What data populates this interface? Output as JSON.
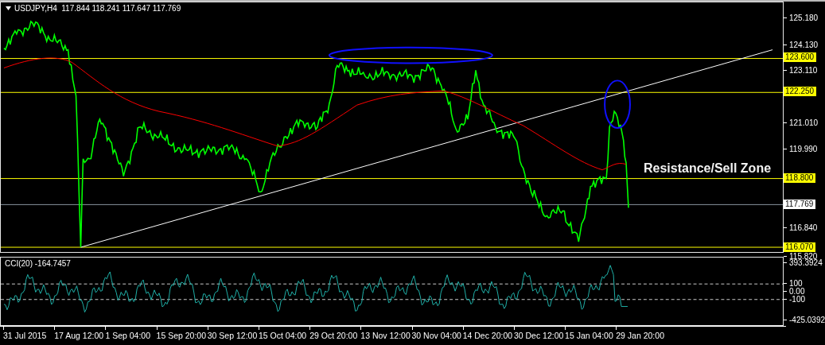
{
  "chart": {
    "header": "USDJPY,H4  117.844 118.241 117.647 117.769",
    "annotation": "Resistance/Sell Zone",
    "price_ticks": [
      "125.180",
      "124.130",
      "123.110",
      "121.010",
      "119.990",
      "116.840",
      "115.820"
    ],
    "price_levels": [
      {
        "label": "123.600",
        "kind": "level"
      },
      {
        "label": "122.250",
        "kind": "level"
      },
      {
        "label": "118.800",
        "kind": "level"
      },
      {
        "label": "117.769",
        "kind": "current"
      },
      {
        "label": "116.070",
        "kind": "level"
      }
    ]
  },
  "indicator": {
    "title": "CCI(20) -164.7457",
    "ticks": [
      "393.3924",
      "100",
      "0.00",
      "-100",
      "-425.0392"
    ]
  },
  "time_axis": [
    "31 Jul 2015",
    "17 Aug 12:00",
    "1 Sep 04:00",
    "15 Sep 20:00",
    "30 Sep 12:00",
    "15 Oct 04:00",
    "29 Oct 20:00",
    "13 Nov 12:00",
    "30 Nov 04:00",
    "14 Dec 20:00",
    "30 Dec 12:00",
    "15 Jan 04:00",
    "29 Jan 20:00"
  ]
}
